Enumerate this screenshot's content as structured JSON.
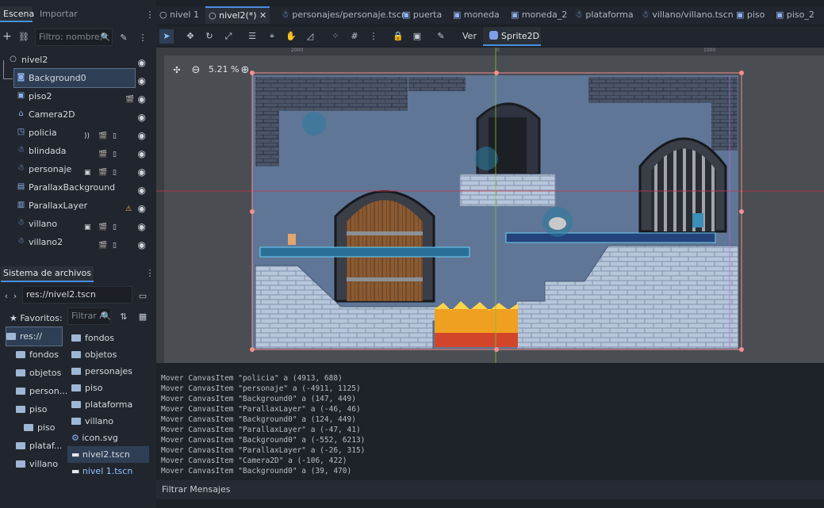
{
  "left_tabs": {
    "scene": "Escena",
    "import": "Importar"
  },
  "scene_filter_placeholder": "Filtro: nombre, t",
  "scene_tree": [
    {
      "label": "nivel2",
      "icon": "node-circle-icon",
      "indent": 0
    },
    {
      "label": "Background0",
      "icon": "sprite-icon",
      "indent": 1,
      "selected": true
    },
    {
      "label": "piso2",
      "icon": "tilemap-icon",
      "indent": 1,
      "badges": [
        "film-icon"
      ]
    },
    {
      "label": "Camera2D",
      "icon": "camera-icon",
      "indent": 1
    },
    {
      "label": "policia",
      "icon": "body-icon",
      "indent": 1,
      "badges": [
        "signal-icon",
        "film-icon",
        "script-icon"
      ]
    },
    {
      "label": "blindada",
      "icon": "character-icon",
      "indent": 1,
      "badges": [
        "film-icon",
        "script-icon"
      ]
    },
    {
      "label": "personaje",
      "icon": "character-icon",
      "indent": 1,
      "badges": [
        "group-icon",
        "film-icon",
        "script-icon"
      ]
    },
    {
      "label": "ParallaxBackground",
      "icon": "parallax-icon",
      "indent": 1
    },
    {
      "label": "ParallaxLayer",
      "icon": "parallax-layer-icon",
      "indent": 1,
      "badges": [
        "warning-icon"
      ]
    },
    {
      "label": "villano",
      "icon": "character-icon",
      "indent": 1,
      "badges": [
        "group-icon",
        "film-icon",
        "script-icon"
      ]
    },
    {
      "label": "villano2",
      "icon": "character-icon",
      "indent": 1,
      "badges": [
        "film-icon",
        "script-icon"
      ]
    }
  ],
  "filesystem": {
    "title": "Sistema de archivos",
    "path": "res://nivel2.tscn",
    "filter_placeholder": "Filtrar A",
    "favorites_label": "Favoritos:",
    "tree": [
      {
        "label": "res://",
        "level": 0,
        "selected": true
      },
      {
        "label": "fondos",
        "level": 1
      },
      {
        "label": "objetos",
        "level": 1
      },
      {
        "label": "person...",
        "level": 1
      },
      {
        "label": "piso",
        "level": 1
      },
      {
        "label": "piso",
        "level": 2
      },
      {
        "label": "plataf...",
        "level": 1
      },
      {
        "label": "villano",
        "level": 1
      }
    ],
    "files": [
      {
        "label": "fondos",
        "type": "folder"
      },
      {
        "label": "objetos",
        "type": "folder"
      },
      {
        "label": "personajes",
        "type": "folder"
      },
      {
        "label": "piso",
        "type": "folder"
      },
      {
        "label": "plataforma",
        "type": "folder"
      },
      {
        "label": "villano",
        "type": "folder"
      },
      {
        "label": "icon.svg",
        "type": "svg"
      },
      {
        "label": "nivel2.tscn",
        "type": "scene",
        "selected": true
      },
      {
        "label": "nivel 1.tscn",
        "type": "scene",
        "link": true
      }
    ]
  },
  "editor_tabs": [
    {
      "label": "nivel 1",
      "icon": "node-circle-icon"
    },
    {
      "label": "nivel2(*)",
      "icon": "node-circle-icon",
      "active": true
    },
    {
      "label": "personajes/personaje.tscn",
      "icon": "character-icon"
    },
    {
      "label": "puerta",
      "icon": "tilemap-icon"
    },
    {
      "label": "moneda",
      "icon": "tilemap-icon"
    },
    {
      "label": "moneda_2",
      "icon": "tilemap-icon"
    },
    {
      "label": "plataforma",
      "icon": "character-icon"
    },
    {
      "label": "villano/villano.tscn",
      "icon": "character-icon"
    },
    {
      "label": "piso",
      "icon": "tilemap-icon"
    },
    {
      "label": "piso_2",
      "icon": "tilemap-icon"
    }
  ],
  "toolbar": {
    "view_label": "Ver",
    "sprite2d_label": "Sprite2D"
  },
  "viewport": {
    "zoom": "5.21 %",
    "ruler_ticks": [
      "2000",
      "0",
      "1000"
    ]
  },
  "output_lines": [
    "Mover CanvasItem \"policia\" a (4913, 688)",
    "Mover CanvasItem \"personaje\" a (-4911, 1125)",
    "Mover CanvasItem \"Background0\" a (147, 449)",
    "Mover CanvasItem \"ParallaxLayer\" a (-46, 46)",
    "Mover CanvasItem \"Background0\" a (124, 449)",
    "Mover CanvasItem \"ParallaxLayer\" a (-47, 41)",
    "Mover CanvasItem \"Background0\" a (-552, 6213)",
    "Mover CanvasItem \"ParallaxLayer\" a (-26, 315)",
    "Mover CanvasItem \"Camera2D\" a (-106, 422)",
    "Mover CanvasItem \"Background0\" a (39, 470)"
  ],
  "filter_messages_label": "Filtrar Mensajes",
  "colors": {
    "accent": "#4a8fe0",
    "selection": "#2e3f55",
    "lava": "#f0a020",
    "wall": "#8fa7c8",
    "sky": "#5a7090"
  }
}
